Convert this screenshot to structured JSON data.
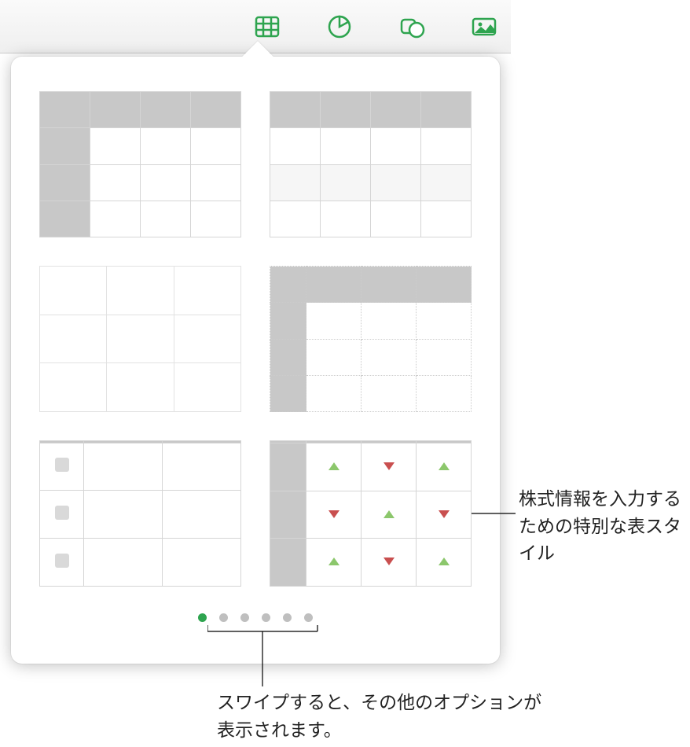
{
  "toolbar": {
    "buttons": [
      {
        "name": "insert-table-button",
        "icon": "table-icon"
      },
      {
        "name": "insert-chart-button",
        "icon": "chart-icon"
      },
      {
        "name": "insert-shape-button",
        "icon": "shape-icon"
      },
      {
        "name": "insert-media-button",
        "icon": "media-icon"
      }
    ]
  },
  "popover": {
    "styles": [
      {
        "name": "table-style-header-row-col"
      },
      {
        "name": "table-style-header-row-striped"
      },
      {
        "name": "table-style-plain"
      },
      {
        "name": "table-style-header-inset"
      },
      {
        "name": "table-style-checklist"
      },
      {
        "name": "table-style-stock"
      }
    ],
    "page_count": 6,
    "active_page": 0
  },
  "callouts": {
    "stock_style": "株式情報を入力するための特別な表スタイル",
    "swipe_hint": "スワイプすると、その他のオプションが表示されます。"
  },
  "colors": {
    "accent": "#2ea44f",
    "header_fill": "#c8c8c8",
    "up": "#8cc76c",
    "down": "#c94f4f"
  }
}
